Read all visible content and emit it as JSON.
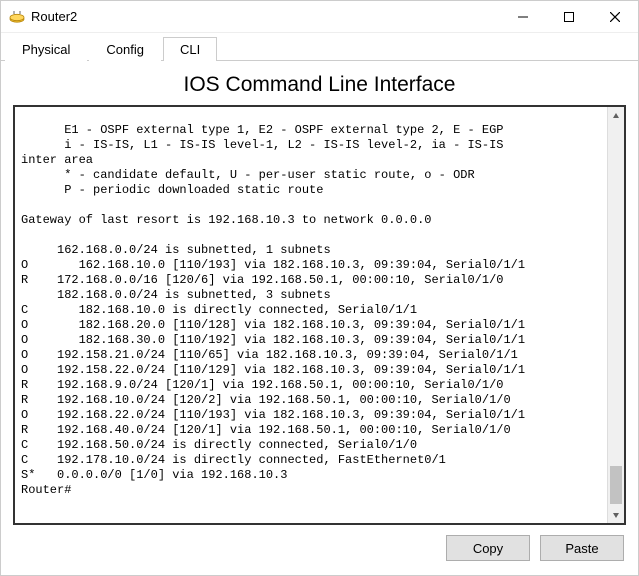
{
  "window": {
    "title": "Router2",
    "icon_name": "router-icon"
  },
  "tabs": [
    {
      "label": "Physical",
      "active": false
    },
    {
      "label": "Config",
      "active": false
    },
    {
      "label": "CLI",
      "active": true
    }
  ],
  "panel": {
    "title": "IOS Command Line Interface"
  },
  "cli_lines": [
    "      E1 - OSPF external type 1, E2 - OSPF external type 2, E - EGP",
    "      i - IS-IS, L1 - IS-IS level-1, L2 - IS-IS level-2, ia - IS-IS",
    "inter area",
    "      * - candidate default, U - per-user static route, o - ODR",
    "      P - periodic downloaded static route",
    "",
    "Gateway of last resort is 192.168.10.3 to network 0.0.0.0",
    "",
    "     162.168.0.0/24 is subnetted, 1 subnets",
    "O       162.168.10.0 [110/193] via 182.168.10.3, 09:39:04, Serial0/1/1",
    "R    172.168.0.0/16 [120/6] via 192.168.50.1, 00:00:10, Serial0/1/0",
    "     182.168.0.0/24 is subnetted, 3 subnets",
    "C       182.168.10.0 is directly connected, Serial0/1/1",
    "O       182.168.20.0 [110/128] via 182.168.10.3, 09:39:04, Serial0/1/1",
    "O       182.168.30.0 [110/192] via 182.168.10.3, 09:39:04, Serial0/1/1",
    "O    192.158.21.0/24 [110/65] via 182.168.10.3, 09:39:04, Serial0/1/1",
    "O    192.158.22.0/24 [110/129] via 182.168.10.3, 09:39:04, Serial0/1/1",
    "R    192.168.9.0/24 [120/1] via 192.168.50.1, 00:00:10, Serial0/1/0",
    "R    192.168.10.0/24 [120/2] via 192.168.50.1, 00:00:10, Serial0/1/0",
    "O    192.168.22.0/24 [110/193] via 182.168.10.3, 09:39:04, Serial0/1/1",
    "R    192.168.40.0/24 [120/1] via 192.168.50.1, 00:00:10, Serial0/1/0",
    "C    192.168.50.0/24 is directly connected, Serial0/1/0",
    "C    192.178.10.0/24 is directly connected, FastEthernet0/1",
    "S*   0.0.0.0/0 [1/0] via 192.168.10.3",
    "Router#"
  ],
  "buttons": {
    "copy": "Copy",
    "paste": "Paste"
  },
  "colors": {
    "window_bg": "#ffffff",
    "border": "#cccccc",
    "cli_border": "#333333",
    "button_bg": "#e1e1e1",
    "button_border": "#adadad"
  }
}
